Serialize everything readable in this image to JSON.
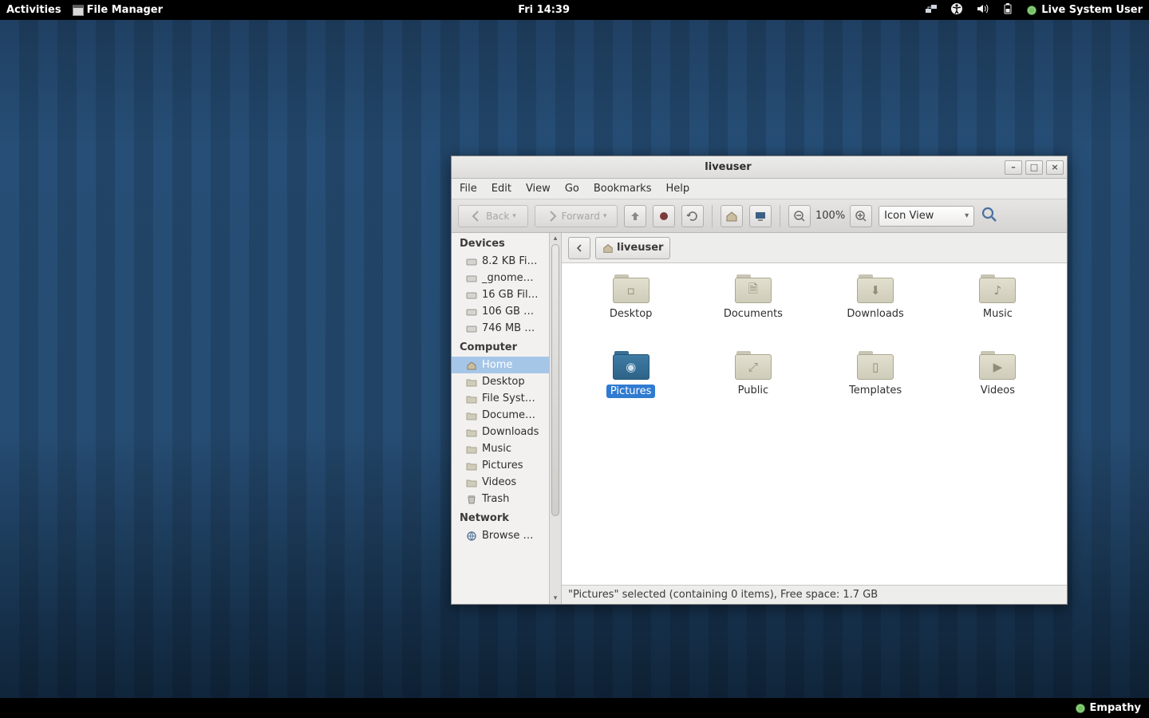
{
  "panel": {
    "activities": "Activities",
    "app_name": "File Manager",
    "clock": "Fri 14:39",
    "user": "Live System User"
  },
  "bottom": {
    "empathy": "Empathy"
  },
  "window": {
    "title": "liveuser",
    "menus": [
      "File",
      "Edit",
      "View",
      "Go",
      "Bookmarks",
      "Help"
    ],
    "toolbar": {
      "back": "Back",
      "forward": "Forward",
      "zoom": "100%",
      "view_mode": "Icon View"
    },
    "path": {
      "current": "liveuser"
    },
    "sidebar": {
      "devices_head": "Devices",
      "devices": [
        "8.2 KB Fi…",
        "_gnome…",
        "16 GB Fil…",
        "106 GB …",
        "746 MB …"
      ],
      "computer_head": "Computer",
      "computer": [
        "Home",
        "Desktop",
        "File Syst…",
        "Docume…",
        "Downloads",
        "Music",
        "Pictures",
        "Videos",
        "Trash"
      ],
      "computer_selected": 0,
      "network_head": "Network",
      "network": [
        "Browse …"
      ]
    },
    "files": [
      {
        "name": "Desktop",
        "glyph": "▫",
        "sel": false
      },
      {
        "name": "Documents",
        "glyph": "🗎",
        "sel": false
      },
      {
        "name": "Downloads",
        "glyph": "⬇",
        "sel": false
      },
      {
        "name": "Music",
        "glyph": "♪",
        "sel": false
      },
      {
        "name": "Pictures",
        "glyph": "◉",
        "sel": true
      },
      {
        "name": "Public",
        "glyph": "⤢",
        "sel": false
      },
      {
        "name": "Templates",
        "glyph": "▯",
        "sel": false
      },
      {
        "name": "Videos",
        "glyph": "▶",
        "sel": false
      }
    ],
    "status": "\"Pictures\" selected (containing 0 items), Free space: 1.7 GB"
  }
}
